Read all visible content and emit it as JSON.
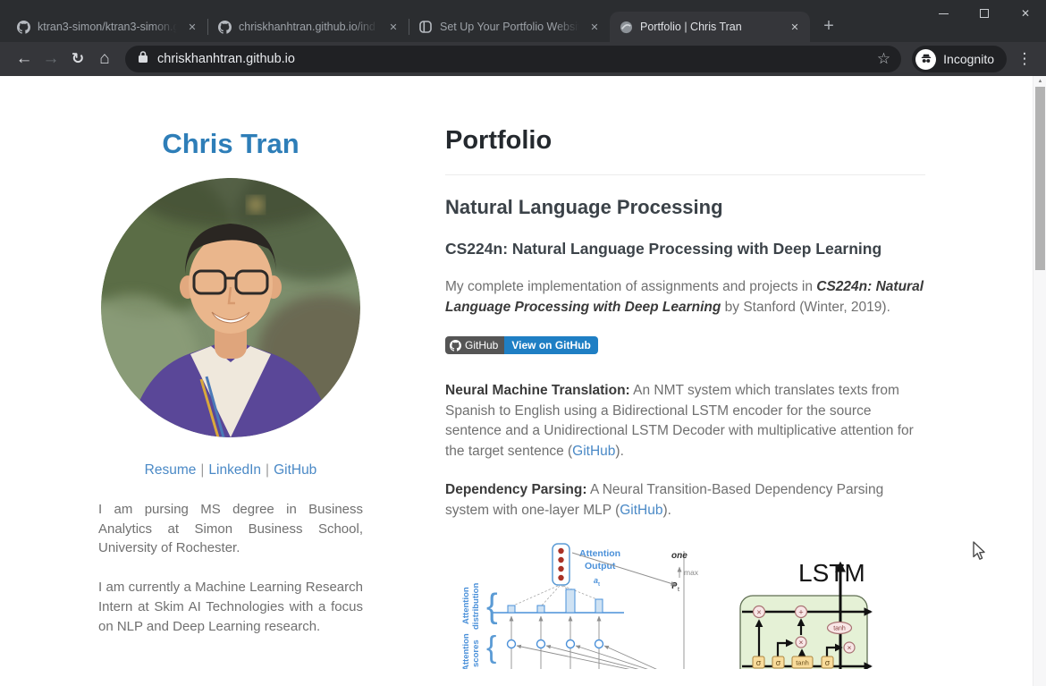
{
  "browser": {
    "tabs": [
      {
        "title": "ktran3-simon/ktran3-simon.g"
      },
      {
        "title": "chriskhanhtran.github.io/ind"
      },
      {
        "title": "Set Up Your Portfolio Websit"
      },
      {
        "title": "Portfolio | Chris Tran"
      }
    ],
    "active_tab_index": 3,
    "tab_close": "✕",
    "new_tab": "+",
    "window_controls": {
      "close": "✕"
    },
    "nav": {
      "back": "←",
      "forward": "→",
      "refresh": "↻",
      "home": "⌂"
    },
    "url": "chriskhanhtran.github.io",
    "bookmark_star": "☆",
    "incognito_label": "Incognito",
    "menu": "⋮"
  },
  "icons": {
    "scroll_up": "▲"
  },
  "sidebar": {
    "name": "Chris Tran",
    "links": [
      {
        "label": "Resume"
      },
      {
        "label": "LinkedIn"
      },
      {
        "label": "GitHub"
      }
    ],
    "separator": "|",
    "bio": [
      "I am pursing MS degree in Business Analytics at Simon Business School, University of Rochester.",
      "I am currently a Machine Learning Research Intern at Skim AI Technologies with a focus on NLP and Deep Learning research."
    ]
  },
  "main": {
    "title": "Portfolio",
    "section": "Natural Language Processing",
    "project_heading": "CS224n: Natural Language Processing with Deep Learning",
    "intro": {
      "prefix": "My complete implementation of assignments and projects in ",
      "emphasis": "CS224n: Natural Language Processing with Deep Learning",
      "suffix": " by Stanford (Winter, 2019)."
    },
    "badge": {
      "left": "GitHub",
      "right": "View on GitHub"
    },
    "projects": [
      {
        "label": "Neural Machine Translation:",
        "text": " An NMT system which translates texts from Spanish to English using a Bidirectional LSTM encoder for the source sentence and a Unidirectional LSTM Decoder with multiplicative attention for the target sentence (",
        "link": "GitHub",
        "after": ")."
      },
      {
        "label": "Dependency Parsing:",
        "text": " A Neural Transition-Based Dependency Parsing system with one-layer MLP (",
        "link": "GitHub",
        "after": ")."
      }
    ]
  },
  "figures": {
    "attention": {
      "output1": "Attention",
      "output2": "Output",
      "sub_a": "a",
      "sub_t": "t",
      "brace": "{",
      "dist1": "Attention",
      "dist2": "distribution",
      "scores1": "Attention",
      "scores2": "scores",
      "axis_one": "one",
      "axis_max": "max",
      "axis_p": "P",
      "axis_pt": "t"
    },
    "lstm": {
      "title": "LSTM",
      "gates": [
        "σ",
        "σ",
        "tanh",
        "σ"
      ],
      "ops": [
        "×",
        "+",
        "×",
        "×"
      ],
      "tanh_label": "tanh"
    }
  },
  "colors": {
    "accent_blue": "#2e7eb8",
    "link_blue": "#4a89c6",
    "badge_gray": "#555555",
    "badge_blue": "#1f7fc4",
    "toolbar_dark": "#35363a",
    "frame_dark": "#2b2d30"
  }
}
